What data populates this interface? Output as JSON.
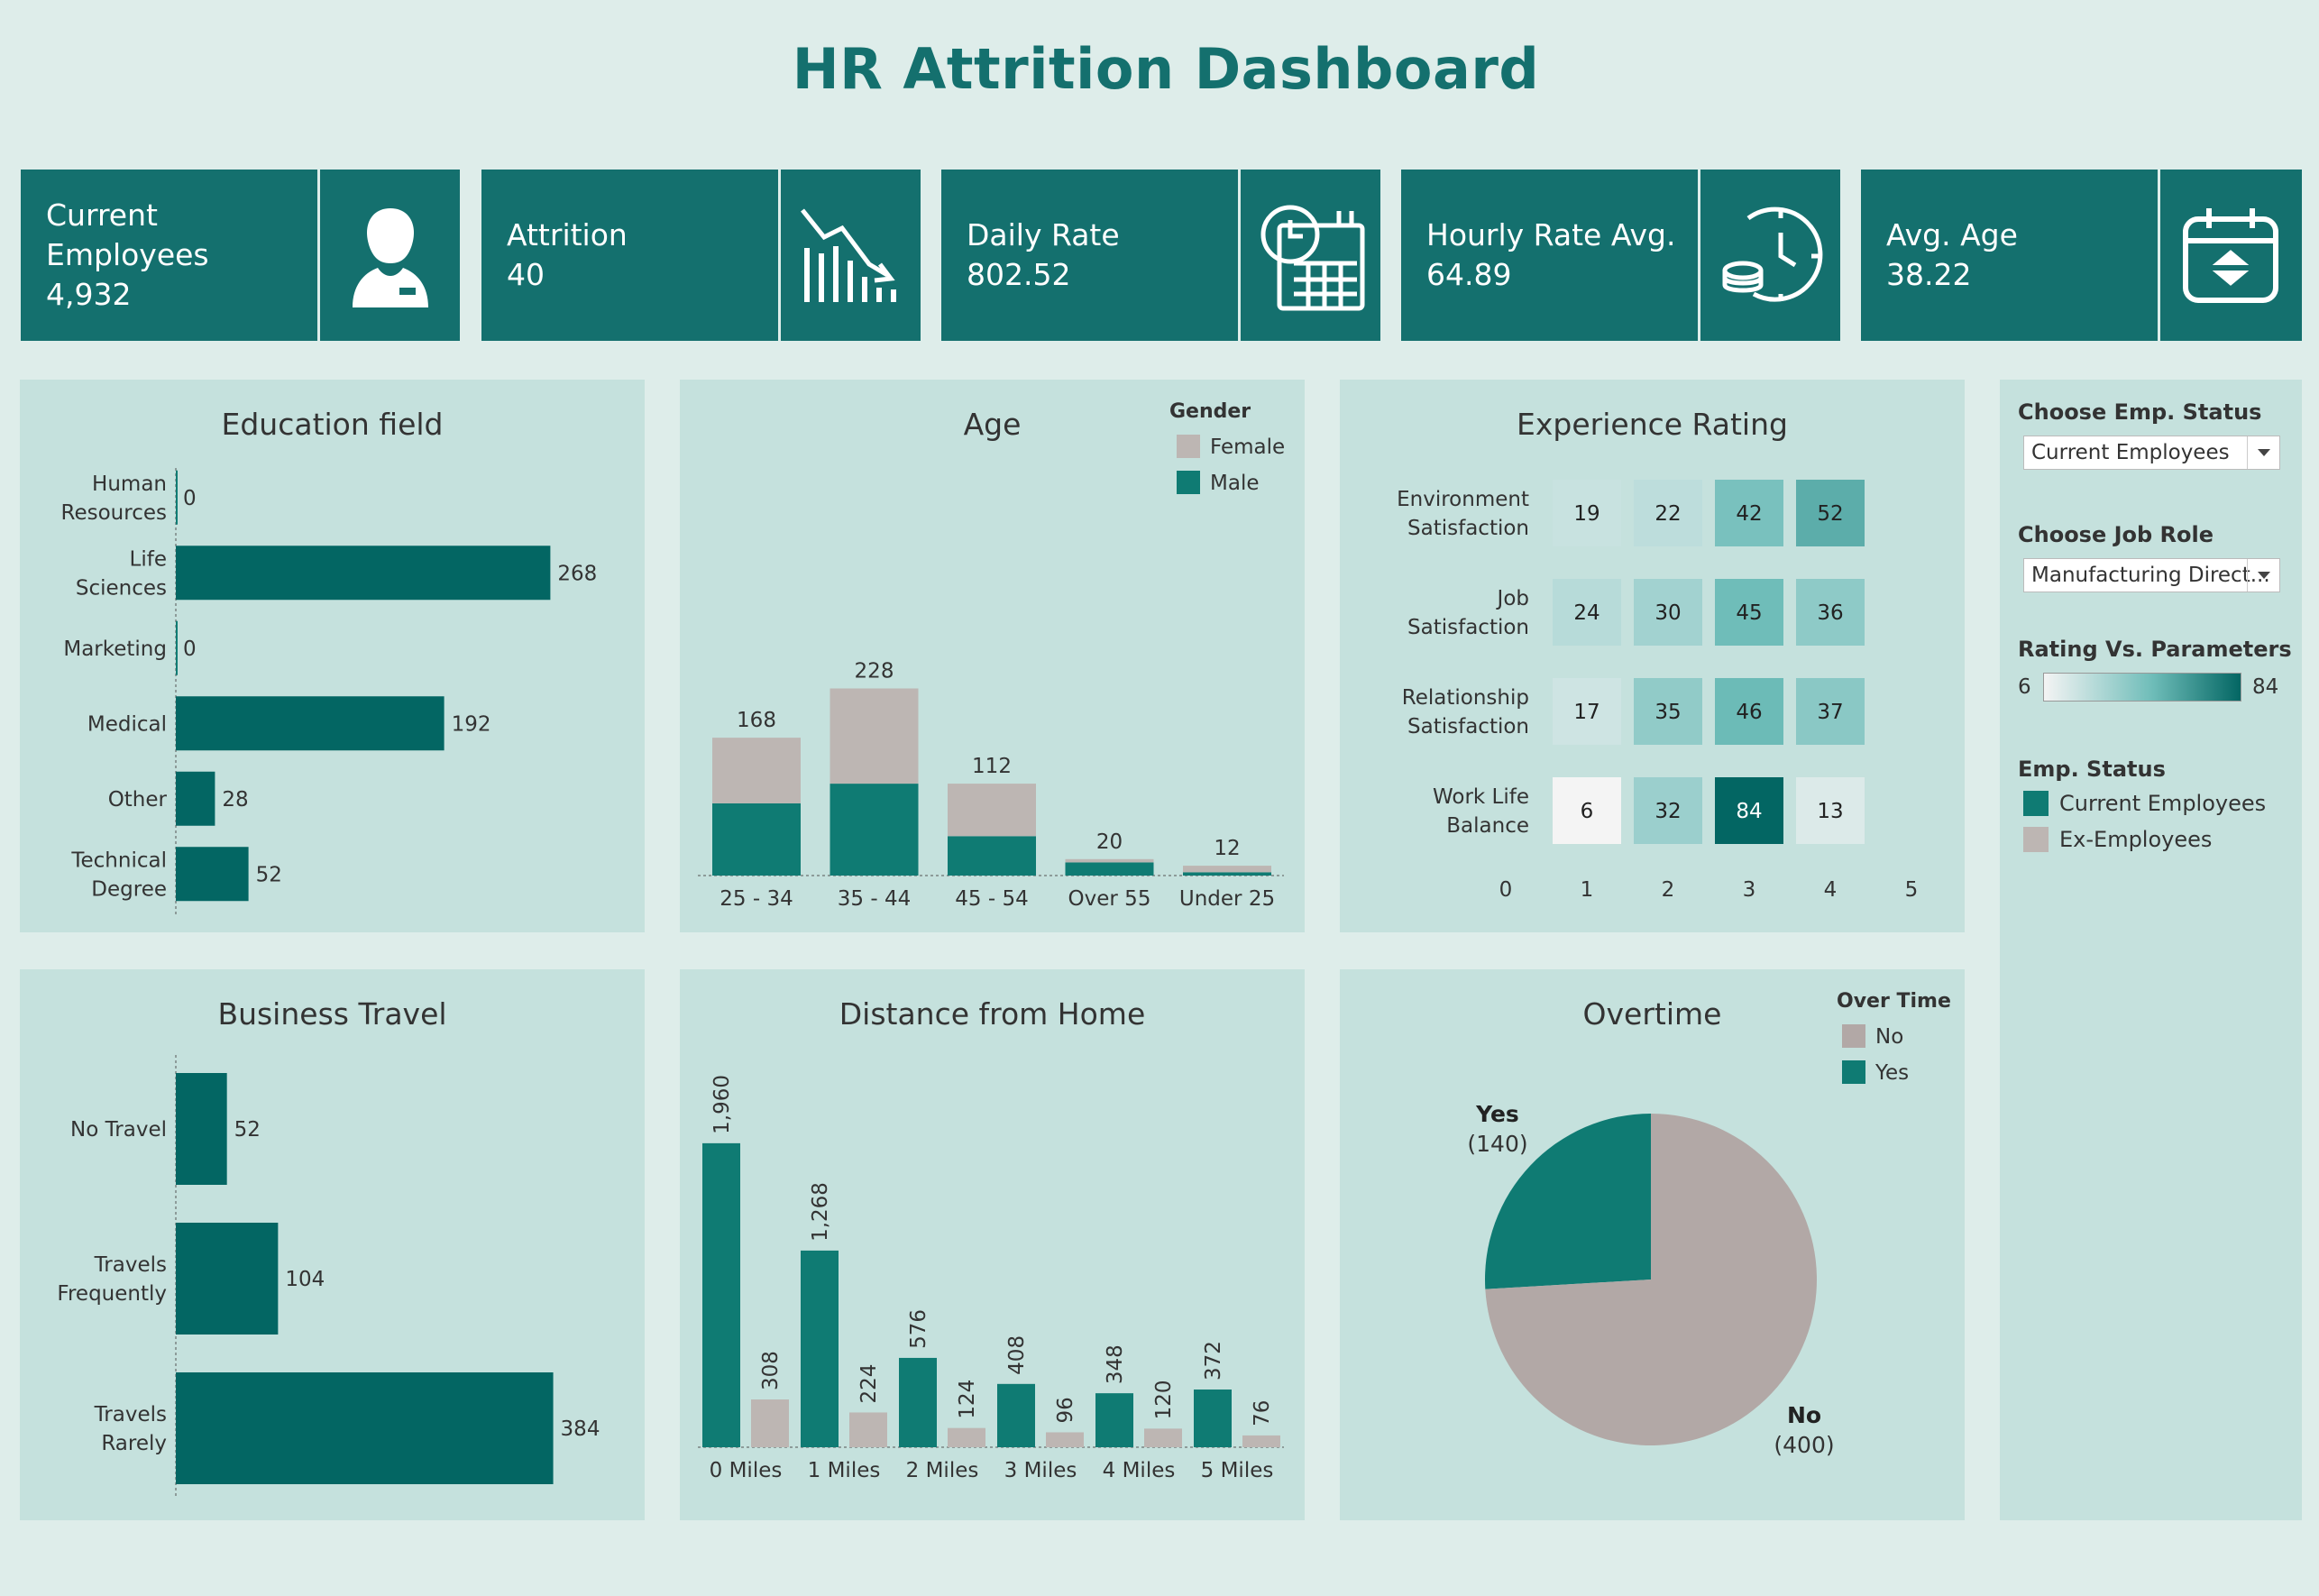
{
  "title": "HR Attrition Dashboard",
  "kpis": [
    {
      "label": "Current Employees",
      "value": "4,932",
      "icon": "employee-icon"
    },
    {
      "label": "Attrition",
      "value": "40",
      "icon": "declining-chart-icon"
    },
    {
      "label": "Daily Rate",
      "value": "802.52",
      "icon": "calendar-clock-icon"
    },
    {
      "label": "Hourly Rate Avg.",
      "value": "64.89",
      "icon": "clock-coins-icon"
    },
    {
      "label": "Avg. Age",
      "value": "38.22",
      "icon": "calendar-icon"
    }
  ],
  "colors": {
    "teal": "#0f7b73",
    "dark_teal": "#036663",
    "grey": "#bdb6b3",
    "panel": "#c5e1dd",
    "bg": "#deedea"
  },
  "education": {
    "title": "Education field",
    "categories": [
      "Human Resources",
      "Life Sciences",
      "Marketing",
      "Medical",
      "Other",
      "Technical Degree"
    ],
    "values": [
      0,
      268,
      0,
      192,
      28,
      52
    ]
  },
  "age": {
    "title": "Age",
    "legend_title": "Gender",
    "legend": [
      "Female",
      "Male"
    ],
    "categories": [
      "25 - 34",
      "35 - 44",
      "45 - 54",
      "Over 55",
      "Under 25"
    ],
    "totals": [
      168,
      228,
      112,
      20,
      12
    ],
    "male": [
      88,
      112,
      48,
      16,
      4
    ],
    "female": [
      80,
      116,
      64,
      4,
      8
    ]
  },
  "experience": {
    "title": "Experience Rating",
    "rows": [
      "Environment Satisfaction",
      "Job Satisfaction",
      "Relationship Satisfaction",
      "Work Life Balance"
    ],
    "x_ticks": [
      "0",
      "1",
      "2",
      "3",
      "4",
      "5"
    ],
    "values": [
      [
        19,
        22,
        42,
        52
      ],
      [
        24,
        30,
        45,
        36
      ],
      [
        17,
        35,
        46,
        37
      ],
      [
        6,
        32,
        84,
        13
      ]
    ]
  },
  "filters": {
    "emp_status_label": "Choose Emp. Status",
    "emp_status_value": "Current Employees",
    "job_role_label": "Choose Job Role",
    "job_role_value": "Manufacturing Direct...",
    "rating_label": "Rating Vs. Parameters",
    "rating_min": "6",
    "rating_max": "84",
    "status_legend_title": "Emp. Status",
    "status_legend": [
      "Current Employees",
      "Ex-Employees"
    ]
  },
  "business_travel": {
    "title": "Business Travel",
    "categories": [
      "No Travel",
      "Travels Frequently",
      "Travels Rarely"
    ],
    "values": [
      52,
      104,
      384
    ]
  },
  "distance": {
    "title": "Distance from Home",
    "categories": [
      "0 Miles",
      "1 Miles",
      "2 Miles",
      "3 Miles",
      "4 Miles",
      "5 Miles"
    ],
    "current": [
      1960,
      1268,
      576,
      408,
      348,
      372
    ],
    "ex": [
      308,
      224,
      124,
      96,
      120,
      76
    ],
    "current_labels": [
      "1,960",
      "1,268",
      "576",
      "408",
      "348",
      "372"
    ],
    "ex_labels": [
      "308",
      "224",
      "124",
      "96",
      "120",
      "76"
    ]
  },
  "overtime": {
    "title": "Overtime",
    "legend_title": "Over Time",
    "legend": [
      "No",
      "Yes"
    ],
    "slices": [
      {
        "label": "Yes",
        "value": 140
      },
      {
        "label": "No",
        "value": 400
      }
    ],
    "yes_label": "Yes",
    "yes_value": "(140)",
    "no_label": "No",
    "no_value": "(400)"
  },
  "chart_data": [
    {
      "type": "bar",
      "title": "Education field",
      "categories": [
        "Human Resources",
        "Life Sciences",
        "Marketing",
        "Medical",
        "Other",
        "Technical Degree"
      ],
      "values": [
        0,
        268,
        0,
        192,
        28,
        52
      ]
    },
    {
      "type": "bar",
      "title": "Age",
      "categories": [
        "25 - 34",
        "35 - 44",
        "45 - 54",
        "Over 55",
        "Under 25"
      ],
      "series": [
        {
          "name": "Male",
          "values": [
            88,
            112,
            48,
            16,
            4
          ]
        },
        {
          "name": "Female",
          "values": [
            80,
            116,
            64,
            4,
            8
          ]
        }
      ],
      "totals": [
        168,
        228,
        112,
        20,
        12
      ]
    },
    {
      "type": "heatmap",
      "title": "Experience Rating",
      "rows": [
        "Environment Satisfaction",
        "Job Satisfaction",
        "Relationship Satisfaction",
        "Work Life Balance"
      ],
      "columns": [
        1,
        2,
        3,
        4
      ],
      "values": [
        [
          19,
          22,
          42,
          52
        ],
        [
          24,
          30,
          45,
          36
        ],
        [
          17,
          35,
          46,
          37
        ],
        [
          6,
          32,
          84,
          13
        ]
      ]
    },
    {
      "type": "bar",
      "title": "Business Travel",
      "categories": [
        "No Travel",
        "Travels Frequently",
        "Travels Rarely"
      ],
      "values": [
        52,
        104,
        384
      ]
    },
    {
      "type": "bar",
      "title": "Distance from Home",
      "categories": [
        "0 Miles",
        "1 Miles",
        "2 Miles",
        "3 Miles",
        "4 Miles",
        "5 Miles"
      ],
      "series": [
        {
          "values": [
            1960,
            1268,
            576,
            408,
            348,
            372
          ]
        },
        {
          "values": [
            308,
            224,
            124,
            96,
            120,
            76
          ]
        }
      ]
    },
    {
      "type": "pie",
      "title": "Overtime",
      "slices": [
        {
          "label": "Yes",
          "value": 140
        },
        {
          "label": "No",
          "value": 400
        }
      ]
    }
  ]
}
